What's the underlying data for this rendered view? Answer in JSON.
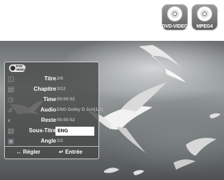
{
  "badges": [
    {
      "label": "DVD-VIDEO",
      "icon": "disc-icon"
    },
    {
      "label": "MPEG4",
      "icon": "disc-icon"
    }
  ],
  "osd": {
    "logo": {
      "line1": "DVD",
      "line2": "VIDEO"
    },
    "rows": [
      {
        "label": "Titre",
        "value": "2/6",
        "icon": "title-icon"
      },
      {
        "label": "Chapitre",
        "value": "3/12",
        "icon": "chapter-icon"
      },
      {
        "label": "Time",
        "value": "00:00:52",
        "icon": "time-icon"
      },
      {
        "label": "Audio",
        "value": "ENG Dolby D 2ch(1/1)",
        "icon": "audio-icon"
      },
      {
        "label": "Reste",
        "value": "00:00:52",
        "icon": "remaining-icon"
      },
      {
        "label": "Sous-Titre",
        "value": "ENG",
        "icon": "subtitle-icon",
        "selected": true
      },
      {
        "label": "Angle",
        "value": "1/1",
        "icon": "angle-icon"
      }
    ],
    "footer": {
      "adjust": "Régler",
      "enter": "Entrée"
    }
  }
}
